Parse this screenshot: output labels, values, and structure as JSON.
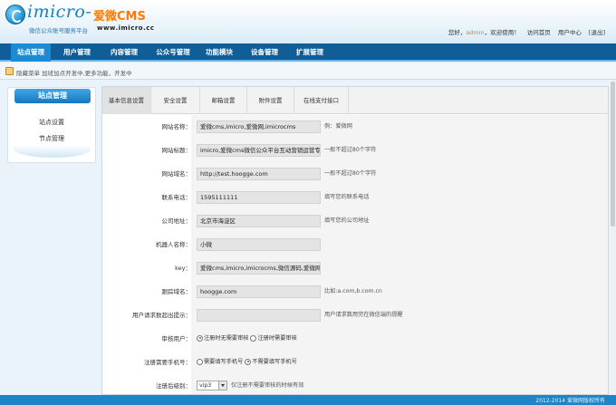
{
  "header": {
    "logo_text": "imicro-",
    "logo_cn": "爱微CMS",
    "slogan": "微信公众账号服务平台",
    "site": "www.imicro.cc",
    "greeting_prefix": "您好，",
    "username": "admin",
    "greeting_suffix": "，欢迎使用！",
    "links": [
      "访问首页",
      "用户中心",
      "[退出]"
    ]
  },
  "nav": {
    "items": [
      "站点管理",
      "用户管理",
      "内容管理",
      "公众号管理",
      "功能模块",
      "设备管理",
      "扩展管理"
    ],
    "active": "站点管理"
  },
  "notice": {
    "text": "隐藏菜单 加班加点开发中,更多功能，开发中"
  },
  "sidebar": {
    "title": "站点管理",
    "items": [
      "站点设置",
      "节点管理"
    ]
  },
  "tabs": [
    "基本信息设置",
    "安全设置",
    "邮箱设置",
    "附件设置",
    "在线支付接口"
  ],
  "active_tab": "基本信息设置",
  "form": {
    "site_name": {
      "label": "网站名称：",
      "value": "爱微cms,imicro,爱微网,imicrocms",
      "hint": "例：爱微网"
    },
    "site_title": {
      "label": "网站标题：",
      "value": "imicro,爱微cms微信公众平台互动营销运营专家",
      "hint": "一般不超过80个字符"
    },
    "site_domain": {
      "label": "网站域名：",
      "value": "http://test.hoogge.com",
      "hint": "一般不超过80个字符"
    },
    "phone": {
      "label": "联系电话：",
      "value": "1595111111",
      "hint": "填写您的联系电话"
    },
    "address": {
      "label": "公司地址：",
      "value": "北京市海淀区",
      "hint": "填写您的公司地址"
    },
    "robot_name": {
      "label": "机器人名称：",
      "value": "小微",
      "hint": ""
    },
    "keywords": {
      "label": "key：",
      "value": "爱微cms,imicro,imicrocms,微信源码,爱微网",
      "hint": ""
    },
    "trace_domain": {
      "label": "跟踪域名：",
      "value": "hoogge.com",
      "hint": "比如:a.com,b.com.cn"
    },
    "overflow_tip": {
      "label": "用户请求数超出提示：",
      "value": "",
      "hint": "用户请求数用完在微信端的提醒"
    },
    "audit_user": {
      "label": "审核用户：",
      "options": [
        "注册时无需要审核",
        "注册时需要审核"
      ],
      "selected": 0
    },
    "require_phone": {
      "label": "注册需要手机号：",
      "options": [
        "需要填写手机号",
        "不需要填写手机号"
      ],
      "selected": 1
    },
    "post_register_level": {
      "label": "注册后级别：",
      "value": "vip3",
      "hint": "仅注册不需要审核的时候有效"
    }
  },
  "footer": {
    "text": "2012-2014 爱微网版权所有"
  }
}
